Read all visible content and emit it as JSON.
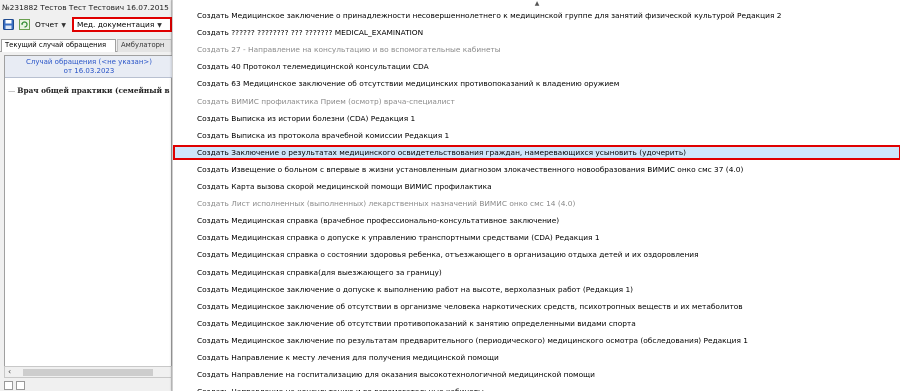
{
  "window": {
    "title": "№231882 Тестов Тест Тестович 16.07.2015"
  },
  "toolbar": {
    "report_label": "Отчет",
    "med_docs_label": "Мед. документация"
  },
  "tabs": [
    {
      "label": "Текущий случай обращения"
    },
    {
      "label": "Амбулаторн"
    }
  ],
  "case": {
    "line1": "Случай обращения (<не указан>)",
    "line2": "от 16.03.2023",
    "doctor": "Врач общей практики (семейный в"
  },
  "dropdown": {
    "items": [
      {
        "label": "Создать  Медицинское заключение о принадлежности несовершеннолетнего к медицинской группе для занятий физической культурой Редакция 2",
        "enabled": true
      },
      {
        "label": "Создать ?????? ???????? ??? ??????? MEDICAL_EXAMINATION",
        "enabled": true
      },
      {
        "label": "Создать 27 - Направление на консультацию и во вспомогательные кабинеты",
        "enabled": false
      },
      {
        "label": "Создать 40 Протокол телемедицинской консультации CDA",
        "enabled": true
      },
      {
        "label": "Создать 63 Медицинское заключение об отсутствии медицинских противопоказаний к владению оружием",
        "enabled": true
      },
      {
        "label": "Создать ВИМИС профилактика Прием (осмотр) врача-специалист",
        "enabled": false
      },
      {
        "label": "Создать Выписка из истории болезни (CDA) Редакция 1",
        "enabled": true
      },
      {
        "label": "Создать Выписка из протокола врачебной комиссии Редакция 1",
        "enabled": true
      },
      {
        "label": "Создать Заключение о результатах медицинского освидетельствования граждан, намеревающихся усыновить (удочерить)",
        "enabled": true,
        "highlighted": true
      },
      {
        "label": "Создать Извещение о больном с впервые в жизни установленным диагнозом злокачественного новообразования ВИМИС онко смс 37 (4.0)",
        "enabled": true
      },
      {
        "label": "Создать Карта вызова скорой медицинской помощи ВИМИС профилактика",
        "enabled": true
      },
      {
        "label": "Создать Лист исполненных (выполненных) лекарственных назначений ВИМИС онко смс 14 (4.0)",
        "enabled": false
      },
      {
        "label": "Создать Медицинская справка (врачебное профессионально-консультативное заключение)",
        "enabled": true
      },
      {
        "label": "Создать Медицинская справка о допуске к управлению транспортными средствами (CDA) Редакция 1",
        "enabled": true
      },
      {
        "label": "Создать Медицинская справка о состоянии здоровья ребенка, отъезжающего в организацию отдыха детей и их оздоровления",
        "enabled": true
      },
      {
        "label": "Создать Медицинская справка(для выезжающего за границу)",
        "enabled": true
      },
      {
        "label": "Создать Медицинское заключение о допуске к выполнению работ на высоте, верхолазных работ (Редакция 1)",
        "enabled": true
      },
      {
        "label": "Создать Медицинское заключение об отсутствии в организме человека наркотических средств, психотропных веществ и их метаболитов",
        "enabled": true
      },
      {
        "label": "Создать Медицинское заключение об отсутствии противопоказаний к занятию определенными видами спорта",
        "enabled": true
      },
      {
        "label": "Создать Медицинское заключение по результатам предварительного (периодического) медицинского осмотра (обследования) Редакция 1",
        "enabled": true
      },
      {
        "label": "Создать Направление к месту лечения для получения медицинской помощи",
        "enabled": true
      },
      {
        "label": "Создать Направление на госпитализацию для оказания высокотехнологичной медицинской помощи",
        "enabled": true
      },
      {
        "label": "Создать Направление на консультацию и во вспомогательные кабинеты",
        "enabled": true
      }
    ]
  },
  "colors": {
    "highlight_border": "#e00000",
    "highlight_bg": "#cfe6fb",
    "disabled_text": "#8a8a8a",
    "case_header_text": "#2a55c8"
  },
  "icons": [
    "save-icon",
    "refresh-icon",
    "caret-down-icon",
    "scroll-up-icon",
    "scroll-left-icon"
  ]
}
